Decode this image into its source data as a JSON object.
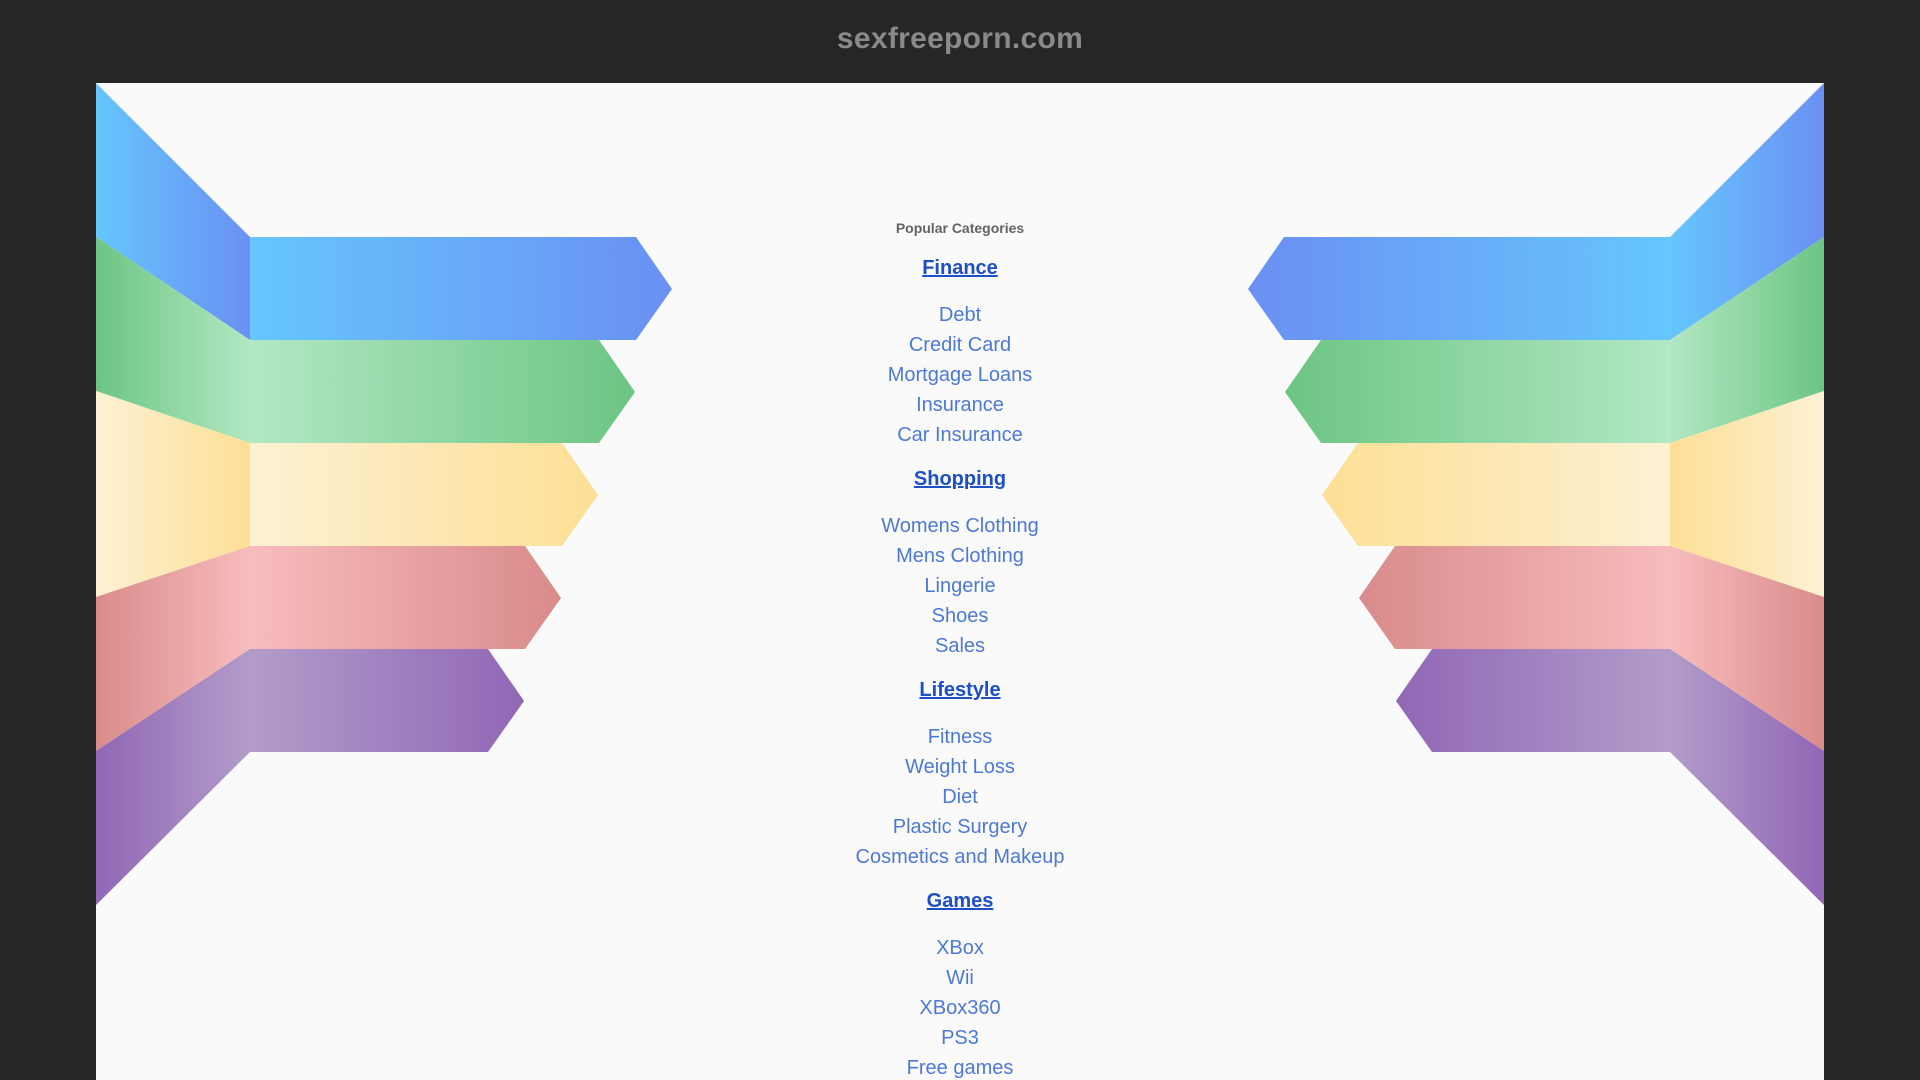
{
  "header": {
    "site_title": "sexfreeporn.com"
  },
  "main": {
    "heading": "Popular Categories",
    "groups": [
      {
        "title": "Finance",
        "links": [
          "Debt",
          "Credit Card",
          "Mortgage Loans",
          "Insurance",
          "Car Insurance"
        ]
      },
      {
        "title": "Shopping",
        "links": [
          "Womens Clothing",
          "Mens Clothing",
          "Lingerie",
          "Shoes",
          "Sales"
        ]
      },
      {
        "title": "Lifestyle",
        "links": [
          "Fitness",
          "Weight Loss",
          "Diet",
          "Plastic Surgery",
          "Cosmetics and Makeup"
        ]
      },
      {
        "title": "Games",
        "links": [
          "XBox",
          "Wii",
          "XBox360",
          "PS3",
          "Free games"
        ]
      }
    ]
  },
  "colors": {
    "background": "#262626",
    "panel": "#fafafa",
    "title_text": "#8a8a8a",
    "category_title": "#1d4fc6",
    "category_link": "#4d79d6",
    "band_blue": "#5f96f5",
    "band_green": "#72c98a",
    "band_yellow": "#fde3a0",
    "band_red": "#e8a3a3",
    "band_purple": "#9b78bd"
  }
}
